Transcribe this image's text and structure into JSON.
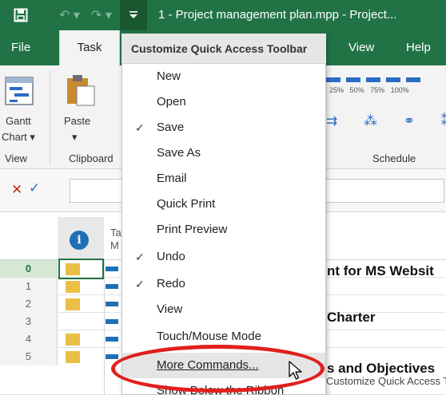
{
  "title_bar": {
    "title": "1 - Project management plan.mpp  -  Project...",
    "save_icon": "save-icon",
    "undo_icon": "undo-icon",
    "redo_icon": "redo-icon",
    "qat_icon": "customize-qat-icon",
    "accent": "#217346"
  },
  "ribbon": {
    "tabs": {
      "file": "File",
      "task": "Task",
      "view": "View",
      "help": "Help"
    },
    "gantt_label": "Gantt",
    "chart_label": "Chart",
    "paste_label": "Paste",
    "group_view": "View",
    "group_clipboard": "Clipboard",
    "group_schedule": "Schedule",
    "percent_labels": [
      "25%",
      "50%",
      "75%",
      "100%"
    ]
  },
  "grid": {
    "rows": [
      {
        "num": "0",
        "task": "nt for MS Websit"
      },
      {
        "num": "1",
        "task": ""
      },
      {
        "num": "2",
        "task": "Charter"
      },
      {
        "num": "3",
        "task": ""
      },
      {
        "num": "4",
        "task": "s and Objectives"
      },
      {
        "num": "5",
        "task": ""
      }
    ],
    "header_peek": "Ta\nM"
  },
  "menu": {
    "header": "Customize Quick Access Toolbar",
    "items": [
      {
        "label": "New",
        "checked": false
      },
      {
        "label": "Open",
        "checked": false
      },
      {
        "label": "Save",
        "checked": true
      },
      {
        "label": "Save As",
        "checked": false
      },
      {
        "label": "Email",
        "checked": false
      },
      {
        "label": "Quick Print",
        "checked": false
      },
      {
        "label": "Print Preview",
        "checked": false
      },
      {
        "label": "Undo",
        "checked": true
      },
      {
        "label": "Redo",
        "checked": true
      },
      {
        "label": "View",
        "checked": false
      },
      {
        "label": "Touch/Mouse Mode",
        "checked": false
      },
      {
        "label": "More Commands...",
        "checked": false,
        "highlighted": true
      },
      {
        "label": "Show Below the Ribbon",
        "checked": false
      }
    ],
    "check_glyph": "✓",
    "tooltip_peek": "Customize Quick Access T"
  },
  "annotation": {
    "callout_color": "#e0201e"
  }
}
